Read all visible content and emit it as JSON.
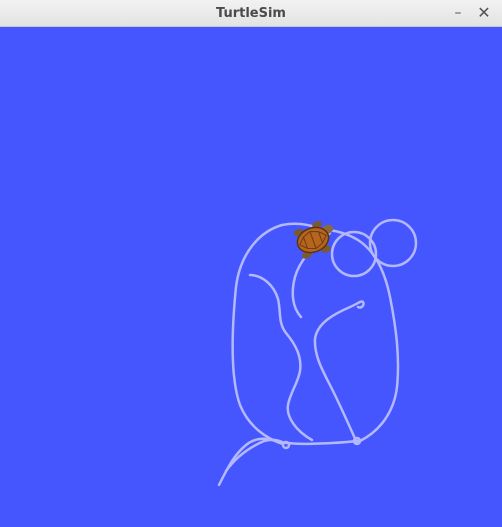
{
  "window": {
    "title": "TurtleSim",
    "controls": {
      "minimize_glyph": "–",
      "close_glyph": "✕"
    }
  },
  "canvas": {
    "background_color": "#4556ff",
    "pen_color": "#b3b8ff"
  },
  "turtle": {
    "icon": "turtle-icon",
    "shell_color": "#b5651d",
    "heading": "up-right"
  }
}
